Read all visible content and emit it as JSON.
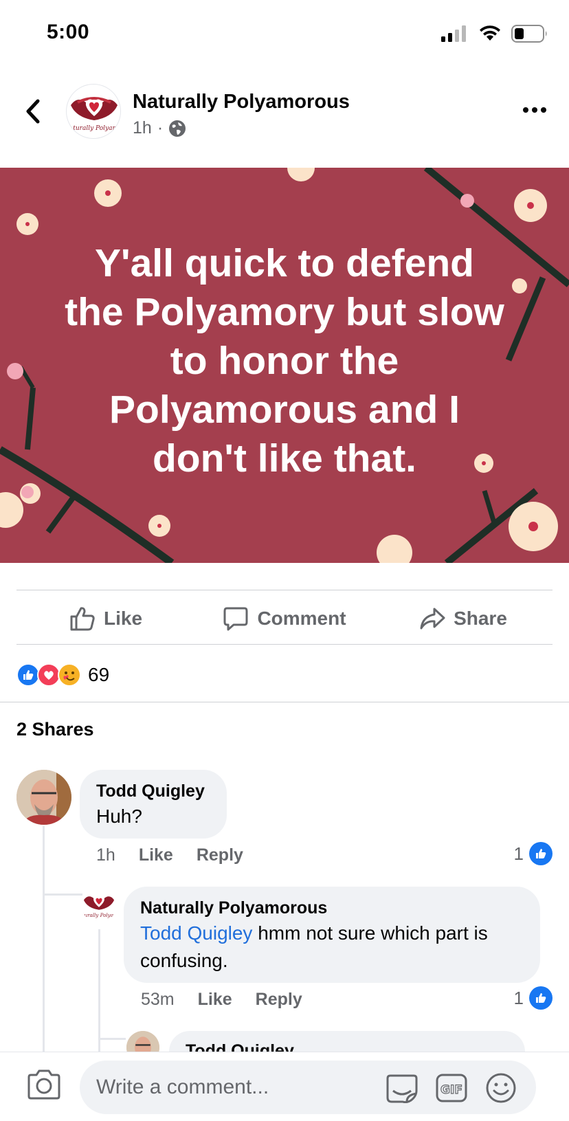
{
  "status_bar": {
    "time": "5:00"
  },
  "post": {
    "page_name": "Naturally Polyamorous",
    "time": "1h",
    "separator": "·",
    "avatar_text": "turally Polyar",
    "image_lines": [
      "Y'all quick to defend",
      "the Polyamory but slow",
      "to honor the",
      "Polyamorous and I",
      "don't like that."
    ],
    "image_bg_color": "#a43f4e"
  },
  "actions": {
    "like": "Like",
    "comment": "Comment",
    "share": "Share"
  },
  "reactions": {
    "count": "69",
    "types": [
      "like",
      "love",
      "care"
    ]
  },
  "shares": "2 Shares",
  "comments": [
    {
      "author": "Todd Quigley",
      "text": "Huh?",
      "time": "1h",
      "like_label": "Like",
      "reply_label": "Reply",
      "likes": "1"
    },
    {
      "author": "Naturally Polyamorous",
      "mention": "Todd Quigley",
      "text": " hmm not sure which part is confusing.",
      "time": "53m",
      "like_label": "Like",
      "reply_label": "Reply",
      "likes": "1",
      "avatar_text": "turally Polyar"
    },
    {
      "author": "Todd Quigley"
    }
  ],
  "composer": {
    "placeholder": "Write a comment..."
  },
  "colors": {
    "accent": "#1877f2",
    "mention": "#216fdb",
    "muted": "#65676b",
    "bubble": "#f0f2f5"
  }
}
